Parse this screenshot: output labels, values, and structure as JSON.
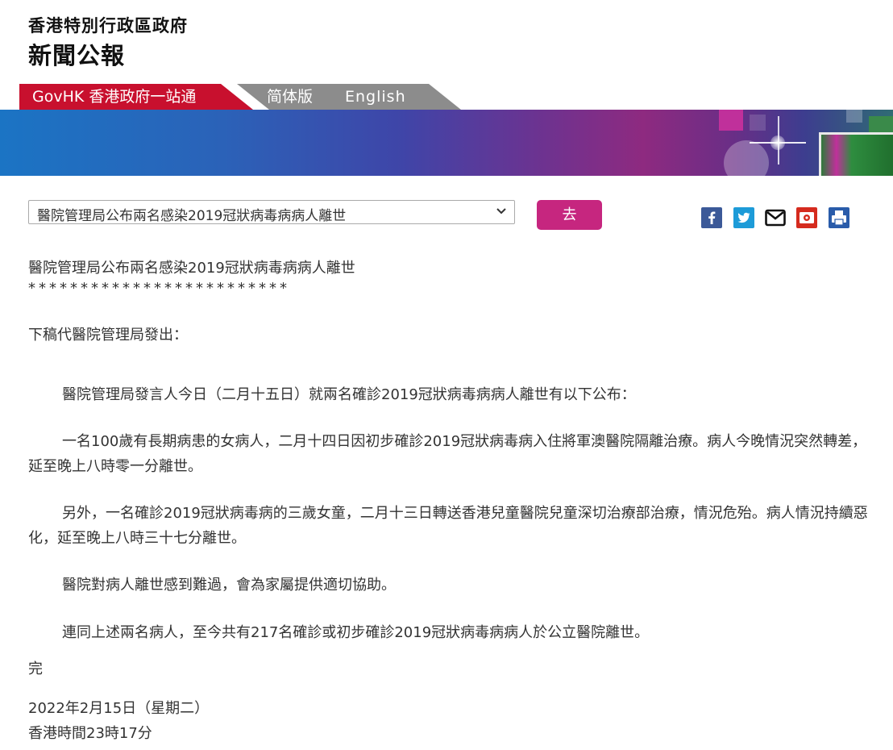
{
  "header": {
    "org": "香港特別行政區政府",
    "title": "新聞公報"
  },
  "nav": {
    "govhk": "GovHK 香港政府一站通",
    "simplified": "简体版",
    "english": "English"
  },
  "selector": {
    "selected": "醫院管理局公布兩名感染2019冠狀病毒病病人離世",
    "go_label": "去"
  },
  "share_icons": [
    "facebook-icon",
    "twitter-icon",
    "email-icon",
    "weibo-icon",
    "print-icon"
  ],
  "colors": {
    "govhk_red": "#c8102e",
    "lang_gray": "#8c8c8c",
    "go_button": "#c6267f"
  },
  "article": {
    "title": "醫院管理局公布兩名感染2019冠狀病毒病病人離世",
    "stars": "*************************",
    "issuer": "下稿代醫院管理局發出：",
    "paragraphs": [
      "醫院管理局發言人今日（二月十五日）就兩名確診2019冠狀病毒病病人離世有以下公布：",
      "一名100歲有長期病患的女病人，二月十四日因初步確診2019冠狀病毒病入住將軍澳醫院隔離治療。病人今晚情況突然轉差，延至晚上八時零一分離世。",
      "另外，一名確診2019冠狀病毒病的三歲女童，二月十三日轉送香港兒童醫院兒童深切治療部治療，情況危殆。病人情況持續惡化，延至晚上八時三十七分離世。",
      "醫院對病人離世感到難過，會為家屬提供適切協助。",
      "連同上述兩名病人，至今共有217名確診或初步確診2019冠狀病毒病病人於公立醫院離世。"
    ],
    "end": "完",
    "date": "2022年2月15日（星期二）",
    "time": "香港時間23時17分"
  }
}
